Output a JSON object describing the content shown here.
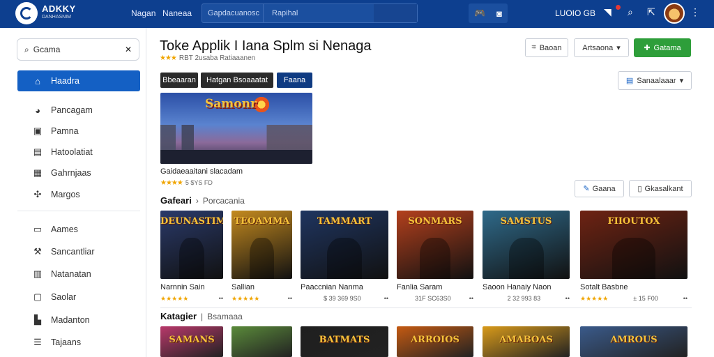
{
  "brand": {
    "name": "ADKKY",
    "sub": "DANHASNIM"
  },
  "nav": [
    "Nagan",
    "Naneaa"
  ],
  "top_search": {
    "category": "Gapdacuanosc",
    "placeholder": "Rapihal"
  },
  "user": {
    "name": "LUOIO GB"
  },
  "sidebar": {
    "search_value": "Gcama",
    "items": [
      {
        "label": "Haadra",
        "icon": "home-icon"
      },
      {
        "label": "Pancagam",
        "icon": "palette-icon"
      },
      {
        "label": "Pamna",
        "icon": "image-icon"
      },
      {
        "label": "Hatoolatiat",
        "icon": "window-icon"
      },
      {
        "label": "Gahrnjaas",
        "icon": "grid-icon"
      },
      {
        "label": "Margos",
        "icon": "puzzle-icon"
      },
      {
        "label": "Aames",
        "icon": "monitor-icon"
      },
      {
        "label": "Sancantliar",
        "icon": "wrench-icon"
      },
      {
        "label": "Natanatan",
        "icon": "document-icon"
      },
      {
        "label": "Saolar",
        "icon": "panel-icon"
      },
      {
        "label": "Madanton",
        "icon": "building-icon"
      },
      {
        "label": "Tajaans",
        "icon": "list-icon"
      }
    ]
  },
  "main": {
    "title": "Toke Applik I Iana Splm si Nenaga",
    "rating_text": "RBT 2usaba Ratiaaanen",
    "buttons": {
      "b1": "Baoan",
      "b2": "Artsaona",
      "b3": "Gatama"
    },
    "tabs": [
      "Bbeaaran",
      "Hatgan Bsoaaatat",
      "Faana"
    ],
    "sort": "Sanaalaaar",
    "hero": {
      "title": "Samonr",
      "caption": "Gaidaeaaitani slacadam",
      "rating": "5 $YS FD"
    },
    "action_buttons": {
      "a1": "Gaana",
      "a2": "Gkasalkant"
    },
    "section1": {
      "title": "Gafeari",
      "sub": "Porcacania"
    },
    "games": [
      {
        "name": "Narnnin Sain",
        "art": "DEUNASTIM",
        "meta": "",
        "stars": "★★★★★",
        "bg": "#2a3a6a"
      },
      {
        "name": "Sallian",
        "art": "TEOAMMA",
        "meta": "",
        "stars": "★★★★★",
        "bg": "#c48a1f"
      },
      {
        "name": "Paaccnian Nanma",
        "art": "TAMMART",
        "meta": "$ 39 369 9S0",
        "stars": "",
        "bg": "#1f3560"
      },
      {
        "name": "Fanlia Saram",
        "art": "SONMARS",
        "meta": "31F SC63S0",
        "stars": "",
        "bg": "#b3401d"
      },
      {
        "name": "Saoon Hanaiy Naon",
        "art": "SAMSTUS",
        "meta": "2 32 993 83",
        "stars": "",
        "bg": "#2f6a8a"
      },
      {
        "name": "Sotalt Basbne",
        "art": "FIIOUTOX",
        "meta": "± 15 F00",
        "stars": "★★★★★",
        "bg": "#6e2313"
      }
    ],
    "section2": {
      "title": "Katagier",
      "sub": "Bsamaaa"
    },
    "games2": [
      {
        "art": "SAMANS",
        "bg": "#b8386a"
      },
      {
        "art": "",
        "bg": "#5a8a3a"
      },
      {
        "art": "BATMATS",
        "bg": "#1f1f1f"
      },
      {
        "art": "ARROIOS",
        "bg": "#c45a12"
      },
      {
        "art": "AMABOAS",
        "bg": "#d89a1a"
      },
      {
        "art": "AMROUS",
        "bg": "#3a5a8a"
      }
    ]
  }
}
